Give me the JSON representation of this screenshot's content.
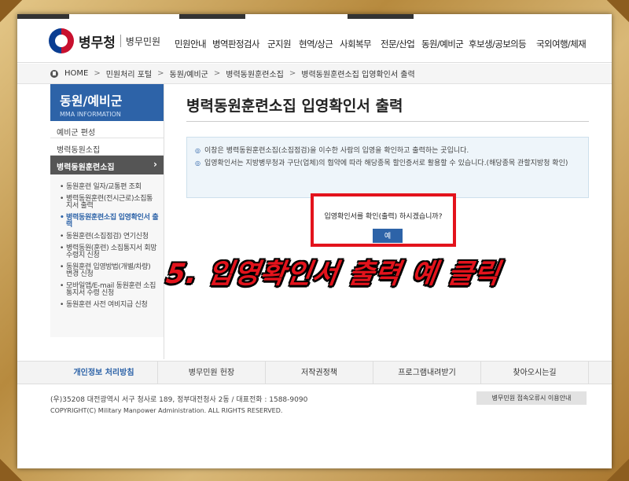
{
  "logo": {
    "name": "병무청",
    "sub": "병무민원"
  },
  "gnb": [
    "민원안내",
    "병역판정검사",
    "군지원",
    "현역/상근",
    "사회복무",
    "전문/산업",
    "동원/예비군",
    "후보생/공보의등",
    "국외여행/체재"
  ],
  "breadcrumb": [
    "HOME",
    "민원처리 포털",
    "동원/예비군",
    "병력동원훈련소집",
    "병력동원훈련소집 입영확인서 출력"
  ],
  "sidebar": {
    "title": "동원/예비군",
    "subtitle": "MMA INFORMATION",
    "items": [
      "예비군 편성",
      "병력동원소집"
    ],
    "active": "병력동원훈련소집",
    "sub_items": [
      "동원훈련 일자/교통편 조회",
      "병력동원훈련(전시근로)소집통지서 출력",
      "병력동원훈련소집 입영확인서 출력",
      "동원훈련(소집점검) 연기신청",
      "병력동원(훈련) 소집통지서 회망수령지 신청",
      "동원훈련 입영방법(개별/차량) 변경 신청",
      "모바일앱/E-mail 동원훈련 소집통지서 수령 신청",
      "동원훈련 사전 여비지급 신청"
    ]
  },
  "content": {
    "title": "병력동원훈련소집 입영확인서 출력",
    "info": [
      "이창은 병력동원훈련소집(소집점검)을 이수한 사람의 입영을 확인하고 출력하는 곳입니다.",
      "입영확인서는 지방병무청과 구단(업체)의 협약에 따라 해당종목 할인증서로 활용할 수 있습니다.(해당종목 관할지방청 확인)"
    ],
    "confirm_text": "입영확인서를 확인(출력) 하시겠습니까?",
    "yes_label": "예"
  },
  "annotation": "5. 입영확인서 출력 예 클릭",
  "footer": {
    "links": [
      "개인정보 처리방침",
      "병무민원 헌장",
      "저작권정책",
      "프로그램내려받기",
      "찾아오시는길"
    ],
    "address": "(우)35208 대전광역시 서구 청사로 189, 정부대전청사 2동 / 대표전화 : 1588-9090",
    "copyright": "COPYRIGHT(C) Military Manpower Administration. ALL RIGHTS RESERVED.",
    "error_button": "병무민원 접속오류시 이용안내"
  },
  "colors": {
    "brand_blue": "#2d63a8",
    "highlight_red": "#e3131c",
    "frame_gold": "#c9a45f"
  }
}
